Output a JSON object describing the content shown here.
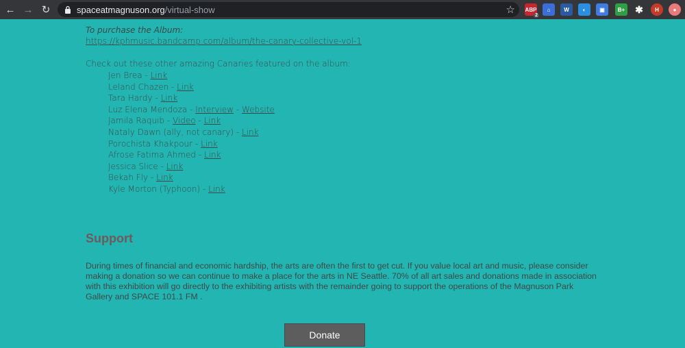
{
  "browser": {
    "url_domain": "spaceatmagnuson.org",
    "url_path": "/virtual-show",
    "extensions": [
      {
        "name": "adblock",
        "label": "ABP",
        "badge": "2",
        "color": "#c7262f"
      },
      {
        "name": "bank",
        "label": "⌂",
        "color": "#3b6fd8"
      },
      {
        "name": "wordcounter",
        "label": "W",
        "color": "#2c5aa0"
      },
      {
        "name": "circle",
        "label": "◐",
        "color": "#2a8fe0"
      },
      {
        "name": "blue-square",
        "label": "▣",
        "color": "#3f7de0"
      },
      {
        "name": "bplus",
        "label": "B+",
        "color": "#2f9e44"
      },
      {
        "name": "puzzle",
        "label": "✱",
        "color": "#35363a"
      },
      {
        "name": "profile",
        "label": "H",
        "color": "#c53b2a"
      },
      {
        "name": "pink",
        "label": "●",
        "color": "#e87a7a"
      }
    ]
  },
  "album": {
    "purchase_label": "To purchase the Album:",
    "purchase_link": "https://kphmusic.bandcamp.com/album/the-canary-collective-vol-1",
    "intro": "Check out these other amazing Canaries featured on the album:"
  },
  "canaries": [
    {
      "name": "Jen Brea - ",
      "links": [
        "Link"
      ]
    },
    {
      "name": "Leland Chazen - ",
      "links": [
        "Link"
      ]
    },
    {
      "name": "Tara Hardy - ",
      "links": [
        "Link"
      ]
    },
    {
      "name": "Luz Elena Mendoza - ",
      "links": [
        "Interview",
        "Website"
      ]
    },
    {
      "name": "Jamila Raquib - ",
      "links": [
        "Video",
        "Link"
      ]
    },
    {
      "name": "Nataly Dawn (ally, not canary) - ",
      "links": [
        "Link"
      ]
    },
    {
      "name": "Porochista Khakpour - ",
      "links": [
        "Link"
      ]
    },
    {
      "name": "Afrose Fatima Ahmed - ",
      "links": [
        "Link"
      ]
    },
    {
      "name": "Jessica Slice - ",
      "links": [
        "Link"
      ]
    },
    {
      "name": "Bekah Fly - ",
      "links": [
        "Link"
      ]
    },
    {
      "name": "Kyle Morton (Typhoon) - ",
      "links": [
        "Link"
      ]
    }
  ],
  "support": {
    "title": "Support",
    "text": "During times of financial and economic hardship, the arts are often the first to get cut. If you value local art and music, please consider making a donation so we can continue to make a place for the arts in NE Seattle. 70% of all art sales and donations made in association with this exhibition will go directly to the exhibiting artists with the remainder going to support the operations of the Magnuson Park Gallery and SPACE 101.1 FM .",
    "donate_label": "Donate"
  }
}
